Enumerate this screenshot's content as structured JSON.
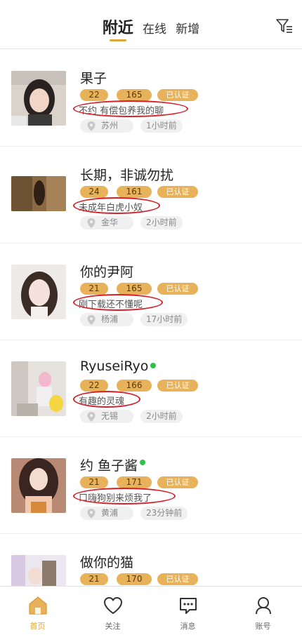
{
  "header": {
    "tabs": [
      {
        "label": "附近",
        "active": true
      },
      {
        "label": "在线",
        "active": false
      },
      {
        "label": "新增",
        "active": false
      }
    ],
    "filter_icon": "filter-icon"
  },
  "users": [
    {
      "name": "果子",
      "online": false,
      "age": "22",
      "height": "165",
      "verified": "已认证",
      "bio": "不约  有偿包养我的聊",
      "location": "苏州",
      "time": "1小时前"
    },
    {
      "name": "长期，非诚勿扰",
      "online": false,
      "age": "24",
      "height": "161",
      "verified": "已认证",
      "bio": "未成年白虎小奴",
      "location": "金华",
      "time": "2小时前"
    },
    {
      "name": "你的尹阿",
      "online": false,
      "age": "21",
      "height": "165",
      "verified": "已认证",
      "bio": "刚下载还不懂呢",
      "location": "杨浦",
      "time": "17小时前"
    },
    {
      "name": "RyuseiRyo",
      "online": true,
      "age": "22",
      "height": "166",
      "verified": "已认证",
      "bio": "有趣的灵魂",
      "location": "无锡",
      "time": "2小时前"
    },
    {
      "name": "约 鱼子酱",
      "online": true,
      "age": "21",
      "height": "171",
      "verified": "已认证",
      "bio": "口嗨狗别来烦我了",
      "location": "黄浦",
      "time": "23分钟前"
    },
    {
      "name": "做你的猫",
      "online": false,
      "age": "21",
      "height": "170",
      "verified": "已认证",
      "bio": "",
      "location": "",
      "time": ""
    }
  ],
  "bottom_nav": [
    {
      "label": "首页",
      "icon": "home-icon",
      "active": true
    },
    {
      "label": "关注",
      "icon": "heart-icon",
      "active": false
    },
    {
      "label": "消息",
      "icon": "message-icon",
      "active": false
    },
    {
      "label": "账号",
      "icon": "account-icon",
      "active": false
    }
  ],
  "colors": {
    "accent": "#e0a83a",
    "tag": "#e8b25b",
    "online": "#2ec24a",
    "highlight_ring": "#d61f28"
  }
}
